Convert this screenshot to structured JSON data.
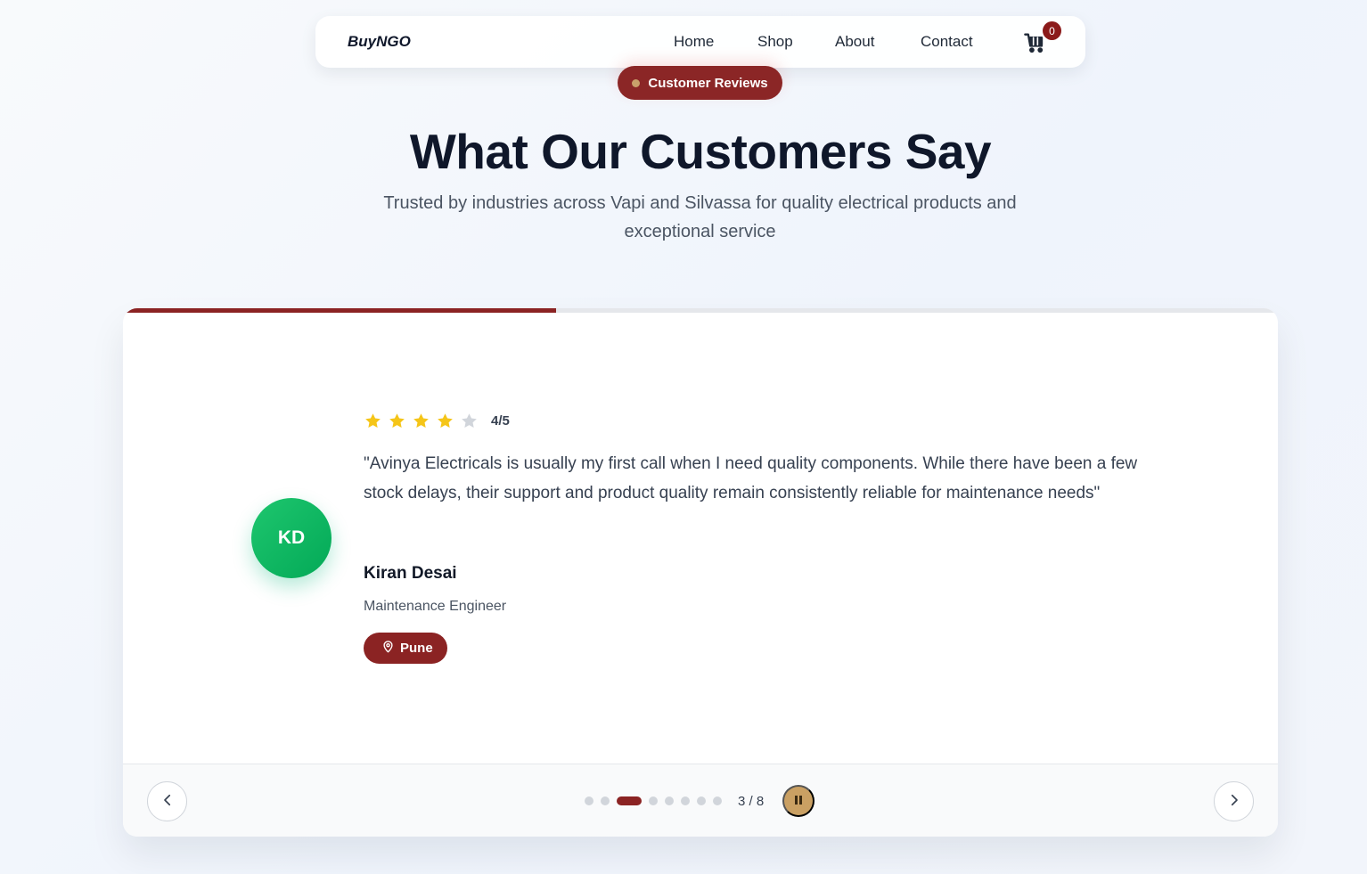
{
  "nav": {
    "brand": "BuyNGO",
    "links": [
      "Home",
      "Shop",
      "About",
      "Contact"
    ],
    "cart_count": "0",
    "cart_icon": "cart-icon"
  },
  "header": {
    "pill": "Customer Reviews",
    "title": "What Our Customers Say",
    "subtitle": "Trusted by industries across Vapi and Silvassa for quality electrical products and exceptional service"
  },
  "testimonial": {
    "initials": "KD",
    "rating": 4,
    "rating_max": 5,
    "rating_text": "4/5",
    "quote": "\"Avinya Electricals is usually my first call when I need quality components. While there have been a few stock delays, their support and product quality remain consistently reliable for maintenance needs\"",
    "name": "Kiran Desai",
    "role": "Maintenance Engineer",
    "location": "Pune"
  },
  "carousel": {
    "current": 3,
    "total": 8,
    "counter": "3 / 8",
    "progress": 0.375,
    "prev_icon": "chevron-left-icon",
    "next_icon": "chevron-right-icon",
    "pause_icon": "pause-icon"
  },
  "colors": {
    "accent": "#8b2323",
    "gold": "#caa063",
    "avatar_green": "#03a957",
    "star_filled": "#f5c518",
    "star_empty": "#d1d5db"
  }
}
